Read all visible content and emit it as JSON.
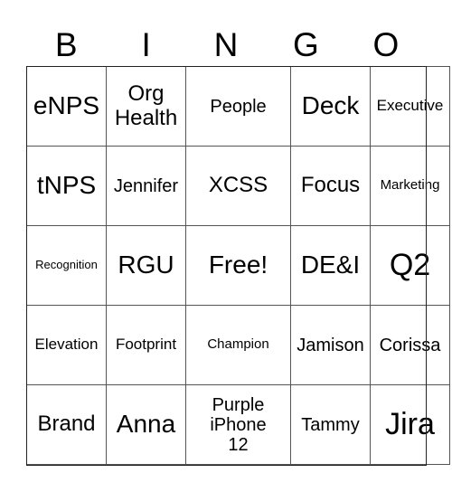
{
  "header": [
    "B",
    "I",
    "N",
    "G",
    "O"
  ],
  "rows": [
    [
      "eNPS",
      "Org Health",
      "People",
      "Deck",
      "Executive"
    ],
    [
      "tNPS",
      "Jennifer",
      "XCSS",
      "Focus",
      "Marketing"
    ],
    [
      "Recognition",
      "RGU",
      "Free!",
      "DE&I",
      "Q2"
    ],
    [
      "Elevation",
      "Footprint",
      "Champion",
      "Jamison",
      "Corissa"
    ],
    [
      "Brand",
      "Anna",
      "Purple iPhone 12",
      "Tammy",
      "Jira"
    ]
  ]
}
